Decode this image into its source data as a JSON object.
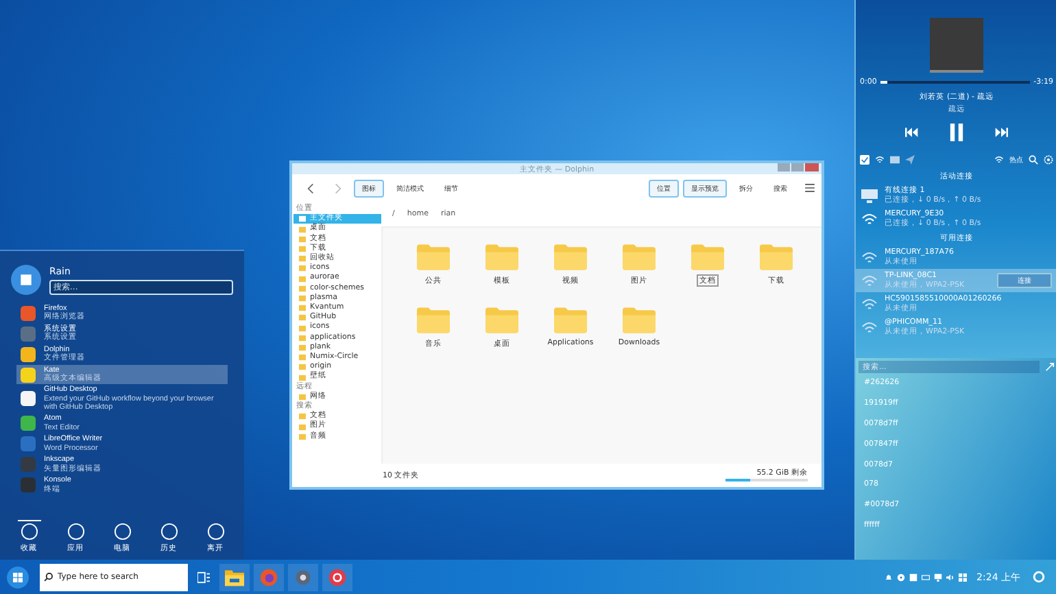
{
  "start_menu": {
    "user": "Rain",
    "search": {
      "placeholder": "搜索..."
    },
    "apps": [
      {
        "name": "Firefox",
        "description": "网络浏览器",
        "color": "#e8562a",
        "selected": false
      },
      {
        "name": "系统设置",
        "description": "系统设置",
        "color": "#5a6f86",
        "selected": false
      },
      {
        "name": "Dolphin",
        "description": "文件管理器",
        "color": "#f2b51b",
        "selected": false
      },
      {
        "name": "Kate",
        "description": "高级文本编辑器",
        "color": "#f6d31b",
        "selected": true
      },
      {
        "name": "GitHub Desktop",
        "description": "Extend your GitHub workflow beyond your browser with GitHub Desktop",
        "color": "#f5f5f5",
        "selected": false
      },
      {
        "name": "Atom",
        "description": "Text Editor",
        "color": "#3fb64a",
        "selected": false
      },
      {
        "name": "LibreOffice Writer",
        "description": "Word Processor",
        "color": "#2b6fc0",
        "selected": false
      },
      {
        "name": "Inkscape",
        "description": "矢量图形编辑器",
        "color": "#333a44",
        "selected": false
      },
      {
        "name": "Konsole",
        "description": "终端",
        "color": "#2a2f36",
        "selected": false
      }
    ],
    "tabs": [
      {
        "label": "收藏",
        "selected": true
      },
      {
        "label": "应用",
        "selected": false
      },
      {
        "label": "电脑",
        "selected": false
      },
      {
        "label": "历史",
        "selected": false
      },
      {
        "label": "离开",
        "selected": false
      }
    ]
  },
  "file_manager": {
    "title": "主文件夹 — Dolphin",
    "toolbar": [
      {
        "label": "图标",
        "selected": true
      },
      {
        "label": "简洁模式",
        "selected": false
      },
      {
        "label": "细节",
        "selected": false
      },
      {
        "label": "位置",
        "selected": true
      },
      {
        "label": "显示预览",
        "selected": true
      },
      {
        "label": "拆分",
        "selected": false
      },
      {
        "label": "搜索",
        "selected": false
      }
    ],
    "sidebar": [
      {
        "heading": "位置",
        "items": [
          {
            "label": "主文件夹",
            "selected": true
          },
          {
            "label": "桌面",
            "selected": false
          },
          {
            "label": "文档",
            "selected": false
          },
          {
            "label": "下载",
            "selected": false
          },
          {
            "label": "回收站",
            "selected": false
          },
          {
            "label": "icons",
            "selected": false
          },
          {
            "label": "aurorae",
            "selected": false
          },
          {
            "label": "color-schemes",
            "selected": false
          },
          {
            "label": "plasma",
            "selected": false
          },
          {
            "label": "Kvantum",
            "selected": false
          },
          {
            "label": "GitHub",
            "selected": false
          },
          {
            "label": "icons",
            "selected": false
          },
          {
            "label": "applications",
            "selected": false
          },
          {
            "label": "plank",
            "selected": false
          },
          {
            "label": "Numix-Circle",
            "selected": false
          },
          {
            "label": "origin",
            "selected": false
          },
          {
            "label": "壁纸",
            "selected": false
          }
        ]
      },
      {
        "heading": "远程",
        "items": [
          {
            "label": "网络",
            "selected": false
          }
        ]
      },
      {
        "heading": "搜索",
        "items": [
          {
            "label": "文档",
            "selected": false
          },
          {
            "label": "图片",
            "selected": false
          },
          {
            "label": "音频",
            "selected": false
          }
        ]
      }
    ],
    "breadcrumb": [
      "/",
      "home",
      "rian"
    ],
    "files": [
      {
        "name": "公共",
        "selected": false
      },
      {
        "name": "模板",
        "selected": false
      },
      {
        "name": "视频",
        "selected": false
      },
      {
        "name": "图片",
        "selected": false
      },
      {
        "name": "文档",
        "selected": true
      },
      {
        "name": "下载",
        "selected": false
      },
      {
        "name": "音乐",
        "selected": false
      },
      {
        "name": "桌面",
        "selected": false
      },
      {
        "name": "Applications",
        "selected": false
      },
      {
        "name": "Downloads",
        "selected": false
      }
    ],
    "status": "10 文件夹",
    "free_space": "55.2 GiB 剩余",
    "level": 0.3
  },
  "panel": {
    "media": {
      "elapsed": "0:00",
      "remaining": "-3:19",
      "level": 0.04,
      "title": "刘若英 (二道) - 疏远",
      "artist": "疏远"
    },
    "network": {
      "hotspot": "热点",
      "active_heading": "活动连接",
      "available_heading": "可用连接",
      "active": [
        {
          "name": "有线连接 1",
          "status": "已连接，↓ 0 B/s，↑ 0 B/s",
          "kind": "wired",
          "selected": false
        },
        {
          "name": "MERCURY_9E30",
          "status": "已连接，↓ 0 B/s，↑ 0 B/s",
          "kind": "wifi",
          "selected": false
        }
      ],
      "available": [
        {
          "name": "MERCURY_187A76",
          "status": "从未使用",
          "kind": "wifi",
          "selected": false
        },
        {
          "name": "TP-LINK_08C1",
          "status": "从未使用，WPA2-PSK",
          "kind": "wifi",
          "selected": true
        },
        {
          "name": "HC5901585510000A01260266",
          "status": "从未使用",
          "kind": "wifi",
          "selected": false
        },
        {
          "name": "@PHICOMM_11",
          "status": "从未使用，WPA2-PSK",
          "kind": "wifi",
          "selected": false
        }
      ],
      "connect_button": "连接"
    },
    "clipboard": {
      "search": {
        "placeholder": "搜索..."
      },
      "items": [
        "#262626",
        "191919ff",
        "0078d7ff",
        "007847ff",
        "0078d7",
        "078",
        "#0078d7",
        "ffffff"
      ]
    }
  },
  "taskbar": {
    "search": {
      "placeholder": "Type here to search"
    },
    "clock": "2:24 上午"
  }
}
